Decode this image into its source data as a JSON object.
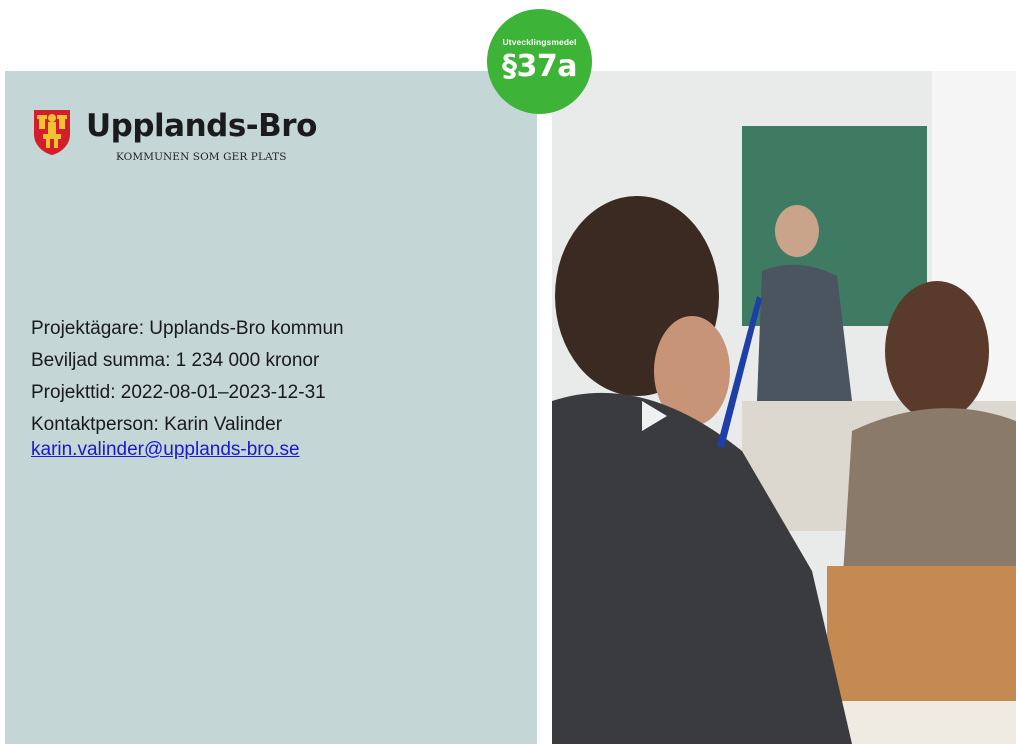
{
  "badge": {
    "label": "Utvecklingsmedel",
    "code": "§37a",
    "color": "#3db338"
  },
  "logo": {
    "name": "Upplands-Bro",
    "tagline": "KOMMUNEN SOM GER PLATS"
  },
  "details": {
    "owner": "Projektägare: Upplands-Bro kommun",
    "amount": "Beviljad summa: 1 234 000 kronor",
    "period": "Projekttid: 2022-08-01–2023-12-31",
    "contact": "Kontaktperson: Karin Valinder",
    "email": "karin.valinder@upplands-bro.se"
  },
  "photo": {
    "icon": "classroom-photo"
  },
  "colors": {
    "panel": "#c5d6d6",
    "link": "#1a1acc"
  }
}
